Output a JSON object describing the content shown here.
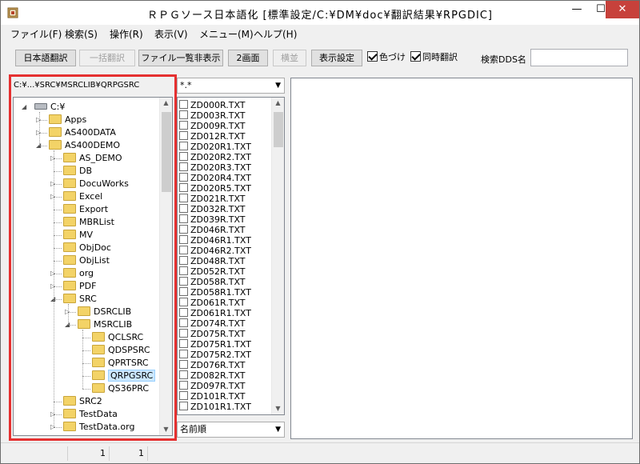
{
  "window": {
    "title": "ＲＰＧソース日本語化 [標準設定/C:¥DM¥doc¥翻訳結果¥RPGDIC]",
    "minimize_glyph": "—",
    "maximize_glyph": "☐",
    "close_glyph": "✕"
  },
  "menu": {
    "items": [
      {
        "label": "ファイル(F)"
      },
      {
        "label": "検索(S)"
      },
      {
        "label": "操作(R)"
      },
      {
        "label": "表示(V)"
      },
      {
        "label": "メニュー(M)"
      },
      {
        "label": "ヘルプ(H)"
      }
    ]
  },
  "toolbar": {
    "translate_label": "日本語翻訳",
    "batch_translate_label": "一括翻訳",
    "hide_file_list_label": "ファイル一覧非表示",
    "two_screen_label": "2画面",
    "side_by_side_label": "横並",
    "display_settings_label": "表示設定",
    "colorize_label": "色づけ",
    "colorize_checked": true,
    "simultaneous_label": "同時翻訳",
    "simultaneous_checked": true,
    "search_dds_label": "検索DDS名",
    "search_dds_value": ""
  },
  "tree": {
    "current_path": "C:¥...¥SRC¥MSRCLIB¥QRPGSRC",
    "nodes": [
      {
        "label": "C:¥",
        "level": 0,
        "expanded": true,
        "drive": true
      },
      {
        "label": "Apps",
        "level": 1,
        "expandable": true
      },
      {
        "label": "AS400DATA",
        "level": 1,
        "expandable": true
      },
      {
        "label": "AS400DEMO",
        "level": 1,
        "expanded": true
      },
      {
        "label": "AS_DEMO",
        "level": 2,
        "expandable": true
      },
      {
        "label": "DB",
        "level": 2
      },
      {
        "label": "DocuWorks",
        "level": 2,
        "expandable": true
      },
      {
        "label": "Excel",
        "level": 2,
        "expandable": true
      },
      {
        "label": "Export",
        "level": 2
      },
      {
        "label": "MBRList",
        "level": 2
      },
      {
        "label": "MV",
        "level": 2
      },
      {
        "label": "ObjDoc",
        "level": 2
      },
      {
        "label": "ObjList",
        "level": 2
      },
      {
        "label": "org",
        "level": 2,
        "expandable": true
      },
      {
        "label": "PDF",
        "level": 2,
        "expandable": true
      },
      {
        "label": "SRC",
        "level": 2,
        "expanded": true
      },
      {
        "label": "DSRCLIB",
        "level": 3,
        "expandable": true
      },
      {
        "label": "MSRCLIB",
        "level": 3,
        "expanded": true
      },
      {
        "label": "QCLSRC",
        "level": 4
      },
      {
        "label": "QDSPSRC",
        "level": 4
      },
      {
        "label": "QPRTSRC",
        "level": 4
      },
      {
        "label": "QRPGSRC",
        "level": 4,
        "selected": true
      },
      {
        "label": "QS36PRC",
        "level": 4
      },
      {
        "label": "SRC2",
        "level": 2
      },
      {
        "label": "TestData",
        "level": 2,
        "expandable": true
      },
      {
        "label": "TestData.org",
        "level": 2,
        "expandable": true
      }
    ]
  },
  "file_filter": {
    "value": "*.*"
  },
  "files": [
    "ZD000R.TXT",
    "ZD003R.TXT",
    "ZD009R.TXT",
    "ZD012R.TXT",
    "ZD020R1.TXT",
    "ZD020R2.TXT",
    "ZD020R3.TXT",
    "ZD020R4.TXT",
    "ZD020R5.TXT",
    "ZD021R.TXT",
    "ZD032R.TXT",
    "ZD039R.TXT",
    "ZD046R.TXT",
    "ZD046R1.TXT",
    "ZD046R2.TXT",
    "ZD048R.TXT",
    "ZD052R.TXT",
    "ZD058R.TXT",
    "ZD058R1.TXT",
    "ZD061R.TXT",
    "ZD061R1.TXT",
    "ZD074R.TXT",
    "ZD075R.TXT",
    "ZD075R1.TXT",
    "ZD075R2.TXT",
    "ZD076R.TXT",
    "ZD082R.TXT",
    "ZD097R.TXT",
    "ZD101R.TXT",
    "ZD101R1.TXT"
  ],
  "sort": {
    "value": "名前順"
  },
  "status": {
    "cell1": "1",
    "cell2": "1"
  },
  "colors": {
    "highlight": "#e53030",
    "selection": "#cce8ff",
    "folder": "#f3d367"
  }
}
